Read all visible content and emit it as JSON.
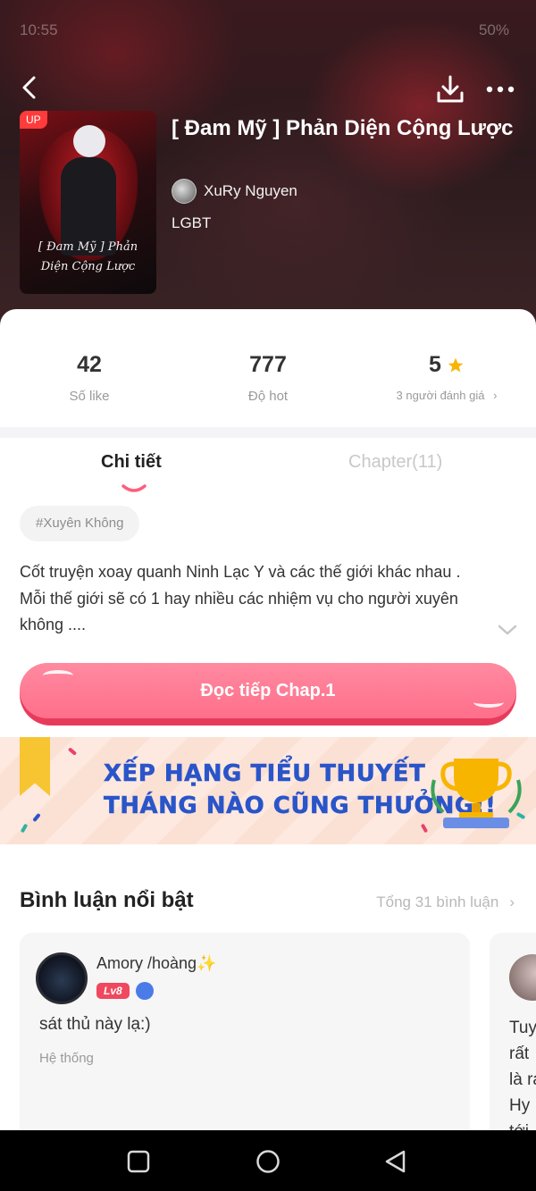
{
  "status_bar": {
    "time": "10:55",
    "battery": "50%"
  },
  "book": {
    "title": "[ Đam Mỹ ] Phản Diện Cộng Lược",
    "author": "XuRy Nguyen",
    "category": "LGBT",
    "cover_badge": "UP",
    "cover_art_text_line1": "[ Đam Mỹ ] Phản",
    "cover_art_text_line2": "Diện Cộng Lược"
  },
  "stats": [
    {
      "value": "42",
      "label": "Số like"
    },
    {
      "value": "777",
      "label": "Độ hot"
    },
    {
      "value": "5",
      "label": "3 người đánh giá",
      "icon": "star-icon",
      "icon_color": "#f7b500"
    }
  ],
  "tabs": {
    "details": "Chi tiết",
    "chapters": "Chapter(11)"
  },
  "tag": "#Xuyên Không",
  "description": "Cốt truyện xoay quanh Ninh Lạc Y và các thế giới khác nhau . Mỗi thế giới sẽ có 1 hay nhiều các nhiệm vụ cho người xuyên không ....",
  "read_button": "Đọc tiếp Chap.1",
  "banner": {
    "line1": "XẾP HẠNG TIỂU THUYẾT",
    "line2": "THÁNG NÀO CŨNG THƯỞNG!!"
  },
  "comments_section": {
    "title": "Bình luận nổi bật",
    "total": "Tổng 31 bình luận",
    "comments": [
      {
        "user": "Amory /hoàng✨",
        "level": "Lv8",
        "text": "sát thủ này lạ:)",
        "source": "Hệ thống"
      },
      {
        "text_lines": [
          "Tuy",
          "rất",
          "là ra",
          "Hy",
          "tới"
        ]
      }
    ]
  },
  "colors": {
    "accent": "#ff6f8b",
    "banner_text": "#2a55c9",
    "star": "#f7b500"
  }
}
